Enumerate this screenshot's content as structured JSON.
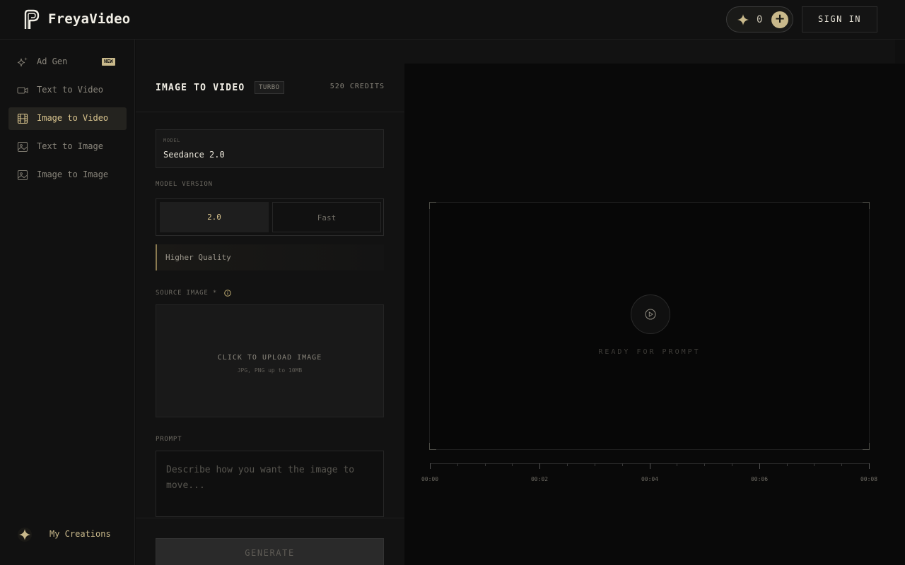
{
  "header": {
    "brand": "FreyaVideo",
    "credits_count": "0",
    "add_label": "+",
    "signin_label": "SIGN IN"
  },
  "sidebar": {
    "items": [
      {
        "label": "Ad Gen",
        "icon": "sparkles-icon",
        "badge": "NEW"
      },
      {
        "label": "Text to Video",
        "icon": "video-camera-icon"
      },
      {
        "label": "Image to Video",
        "icon": "film-icon",
        "active": true
      },
      {
        "label": "Text to Image",
        "icon": "image-icon"
      },
      {
        "label": "Image to Image",
        "icon": "image-icon"
      }
    ],
    "my_creations": "My Creations"
  },
  "panel": {
    "title": "IMAGE TO VIDEO",
    "tag": "TURBO",
    "credits": "520 CREDITS",
    "model_label": "MODEL",
    "model_value": "Seedance 2.0",
    "version_label": "MODEL VERSION",
    "versions": [
      "2.0",
      "Fast"
    ],
    "version_note": "Higher Quality",
    "source_label": "SOURCE IMAGE *",
    "upload_title": "CLICK TO UPLOAD IMAGE",
    "upload_hint": "JPG, PNG up to 10MB",
    "prompt_label": "PROMPT",
    "prompt_placeholder": "Describe how you want the image to move...",
    "generate_label": "GENERATE"
  },
  "preview": {
    "status": "READY FOR PROMPT",
    "timeline_labels": [
      "00:00",
      "00:02",
      "00:04",
      "00:06",
      "00:08"
    ]
  },
  "colors": {
    "accent": "#c9b98b",
    "active_text": "#d9c48e",
    "background": "#0f0f0f"
  }
}
